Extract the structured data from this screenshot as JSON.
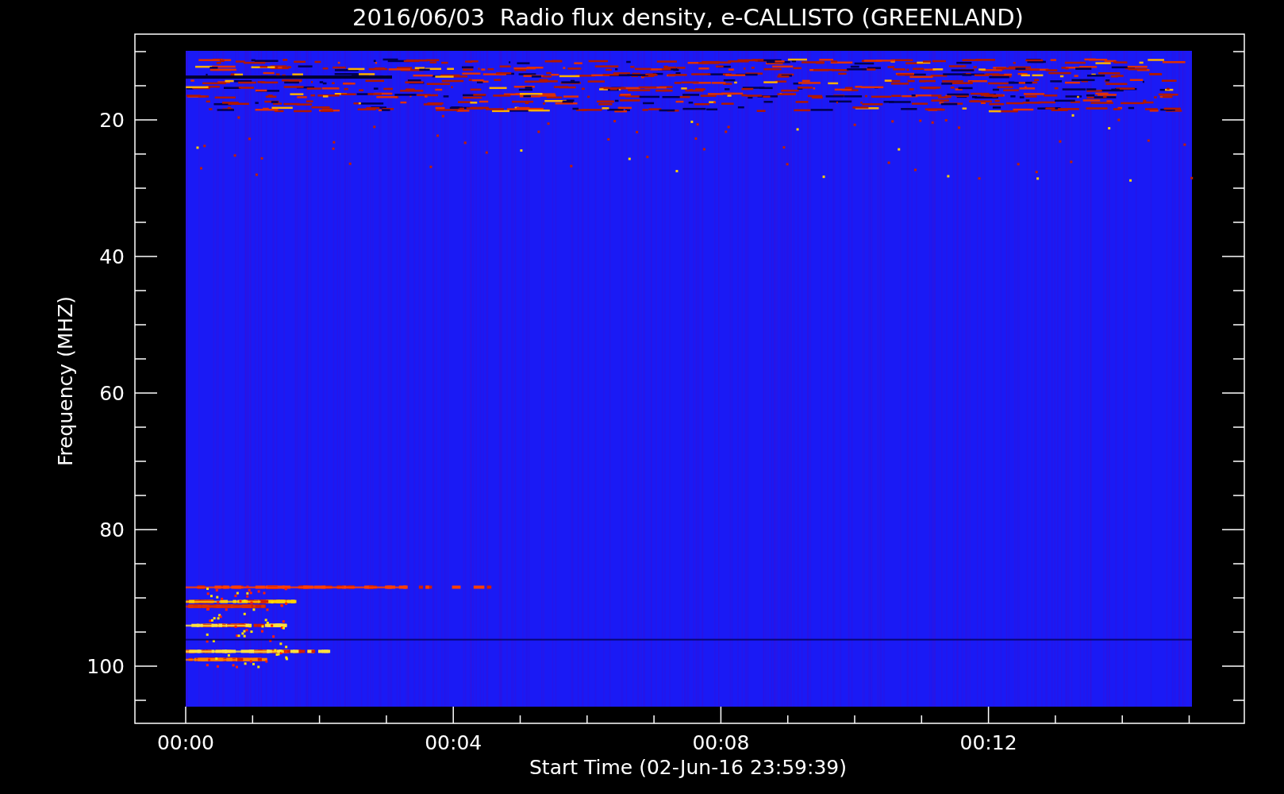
{
  "title": "2016/06/03  Radio flux density, e-CALLISTO (GREENLAND)",
  "y_axis": {
    "label": "Frequency (MHZ)",
    "ticks": [
      "20",
      "40",
      "60",
      "80",
      "100"
    ]
  },
  "x_axis": {
    "label": "Start Time (02-Jun-16 23:59:39)",
    "ticks": [
      "00:00",
      "00:04",
      "00:08",
      "00:12"
    ]
  }
}
